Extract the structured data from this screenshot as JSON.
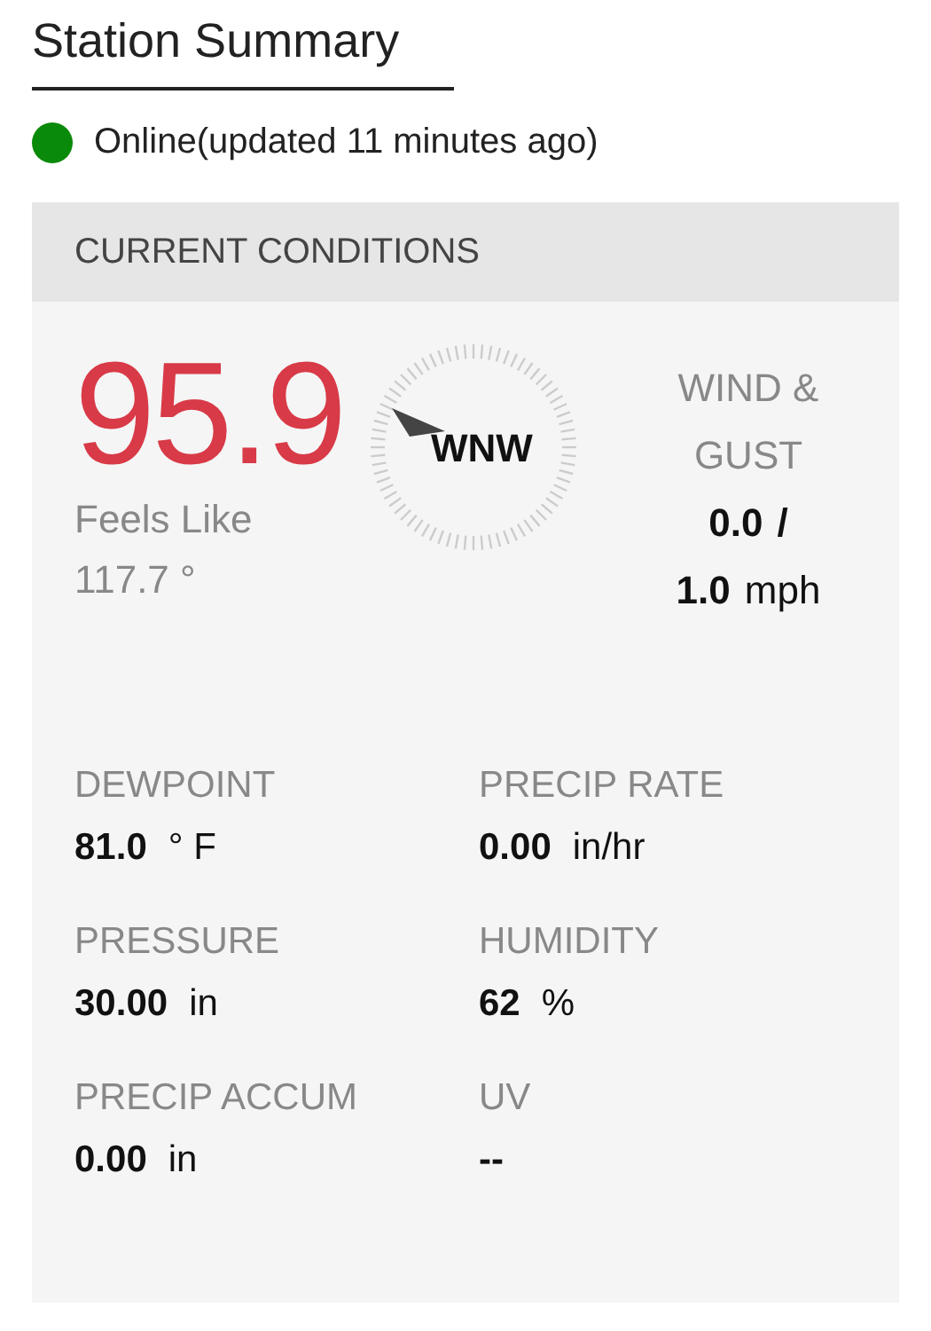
{
  "title": "Station Summary",
  "status": {
    "color": "#0a8a0a",
    "text": "Online(updated 11 minutes ago)"
  },
  "conditions": {
    "header": "CURRENT CONDITIONS",
    "temperature": "95.9",
    "feels_like_label": "Feels Like",
    "feels_like": "117.7 °",
    "wind_direction": "WNW",
    "wind_label": "WIND & GUST",
    "wind_speed": "0.0",
    "wind_separator": "/",
    "gust_speed": "1.0",
    "wind_unit": "mph",
    "metrics": [
      {
        "label": "DEWPOINT",
        "value": "81.0",
        "unit": "° F"
      },
      {
        "label": "PRECIP RATE",
        "value": "0.00",
        "unit": "in/hr"
      },
      {
        "label": "PRESSURE",
        "value": "30.00",
        "unit": "in"
      },
      {
        "label": "HUMIDITY",
        "value": "62",
        "unit": "%"
      },
      {
        "label": "PRECIP ACCUM",
        "value": "0.00",
        "unit": "in"
      },
      {
        "label": "UV",
        "value": "--"
      }
    ]
  }
}
